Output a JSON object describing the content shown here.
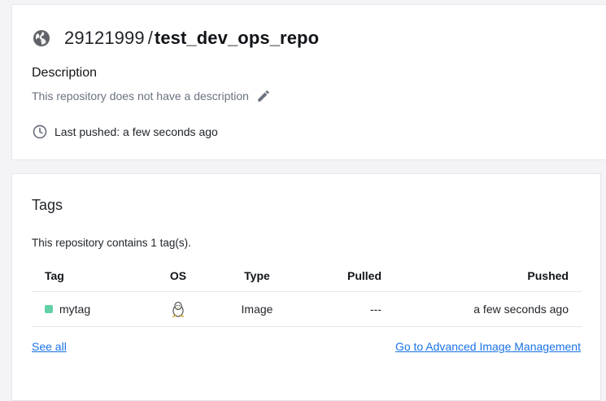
{
  "repo": {
    "namespace": "29121999",
    "separator": "/",
    "name": "test_dev_ops_repo",
    "description_label": "Description",
    "description_text": "This repository does not have a description",
    "last_pushed": "Last pushed: a few seconds ago"
  },
  "tags": {
    "title": "Tags",
    "count_text": "This repository contains 1 tag(s).",
    "columns": [
      "Tag",
      "OS",
      "Type",
      "Pulled",
      "Pushed"
    ],
    "rows": [
      {
        "tag": "mytag",
        "os": "linux-icon",
        "type": "Image",
        "pulled": "---",
        "pushed": "a few seconds ago"
      }
    ],
    "see_all": "See all",
    "advanced_link": "Go to Advanced Image Management"
  },
  "colors": {
    "accent_link": "#1a73e8",
    "tag_dot": "#63d1a8",
    "muted_text": "#6b7280"
  },
  "icons": [
    "globe-icon",
    "pencil-icon",
    "clock-icon",
    "linux-icon"
  ]
}
